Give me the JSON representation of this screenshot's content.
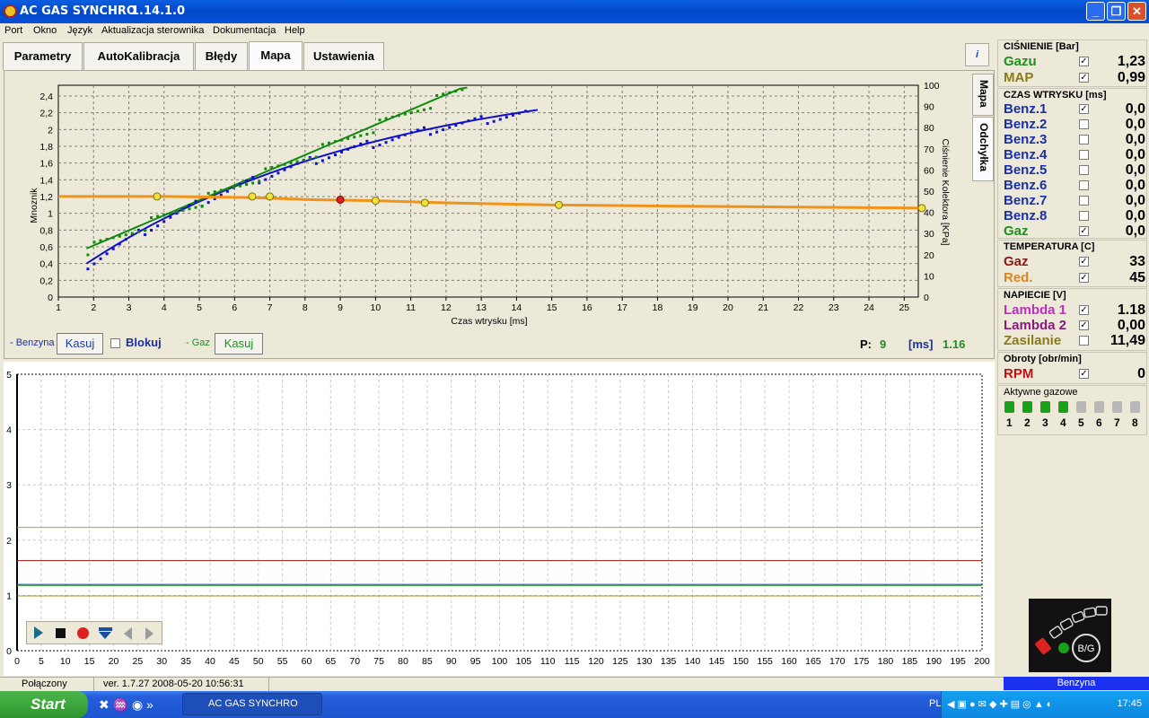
{
  "window": {
    "title": "AC GAS SYNCHRO",
    "version": "1.14.1.0"
  },
  "menu": [
    "Port",
    "Okno",
    "Język",
    "Aktualizacja sterownika",
    "Dokumentacja",
    "Help"
  ],
  "tabs": [
    "Parametry",
    "AutoKalibracja",
    "Błędy",
    "Mapa",
    "Ustawienia"
  ],
  "active_tab": "Mapa",
  "side_tabs": [
    "Mapa",
    "Odchyłka"
  ],
  "map": {
    "ylabel_left": "Mnoznik",
    "ylabel_right": "Ciśnienie Kolektora [KPa]",
    "xlabel": "Czas wtrysku [ms]",
    "left_ticks": [
      "2,4",
      "2,2",
      "2",
      "1,8",
      "1,6",
      "1,4",
      "1,2",
      "1",
      "0,8",
      "0,6",
      "0,4",
      "0,2",
      "0"
    ],
    "right_ticks": [
      "100",
      "90",
      "80",
      "70",
      "60",
      "50",
      "40",
      "30",
      "20",
      "10",
      "0"
    ],
    "x_ticks": [
      "1",
      "2",
      "3",
      "4",
      "5",
      "6",
      "7",
      "8",
      "9",
      "10",
      "11",
      "12",
      "13",
      "14",
      "15",
      "16",
      "17",
      "18",
      "19",
      "20",
      "21",
      "22",
      "23",
      "24",
      "25"
    ]
  },
  "controls": {
    "benzyna_label": "- Benzyna",
    "kasuj1": "Kasuj",
    "blokuj": "Blokuj",
    "gaz_label": "- Gaz",
    "kasuj2": "Kasuj",
    "p_label": "P:",
    "p_value": "9",
    "ms_label": "[ms]",
    "ms_value": "1.16"
  },
  "log": {
    "y_ticks": [
      "5",
      "4",
      "3",
      "2",
      "1",
      "0"
    ],
    "x_ticks": [
      "0",
      "5",
      "10",
      "15",
      "20",
      "25",
      "30",
      "35",
      "40",
      "45",
      "50",
      "55",
      "60",
      "65",
      "70",
      "75",
      "80",
      "85",
      "90",
      "95",
      "100",
      "105",
      "110",
      "115",
      "120",
      "125",
      "130",
      "135",
      "140",
      "145",
      "150",
      "155",
      "160",
      "165",
      "170",
      "175",
      "180",
      "185",
      "190",
      "195",
      "200"
    ]
  },
  "cisnienie": {
    "header": "CIŚNIENIE [Bar]",
    "rows": [
      {
        "name": "Gazu",
        "checked": true,
        "value": "1,23",
        "color": "#1f8f1f"
      },
      {
        "name": "MAP",
        "checked": true,
        "value": "0,99",
        "color": "#8a7a1a"
      }
    ]
  },
  "czas": {
    "header": "CZAS WTRYSKU  [ms]",
    "rows": [
      {
        "name": "Benz.1",
        "checked": true,
        "value": "0,0",
        "color": "#1a2fa8"
      },
      {
        "name": "Benz.2",
        "checked": false,
        "value": "0,0",
        "color": "#1a2fa8"
      },
      {
        "name": "Benz.3",
        "checked": false,
        "value": "0,0",
        "color": "#1a2fa8"
      },
      {
        "name": "Benz.4",
        "checked": false,
        "value": "0,0",
        "color": "#1a2fa8"
      },
      {
        "name": "Benz.5",
        "checked": false,
        "value": "0,0",
        "color": "#1a2fa8"
      },
      {
        "name": "Benz.6",
        "checked": false,
        "value": "0,0",
        "color": "#1a2fa8"
      },
      {
        "name": "Benz.7",
        "checked": false,
        "value": "0,0",
        "color": "#1a2fa8"
      },
      {
        "name": "Benz.8",
        "checked": false,
        "value": "0,0",
        "color": "#1a2fa8"
      },
      {
        "name": "Gaz",
        "checked": true,
        "value": "0,0",
        "color": "#1f8f1f"
      }
    ]
  },
  "temperatura": {
    "header": "TEMPERATURA  [C]",
    "rows": [
      {
        "name": "Gaz",
        "checked": true,
        "value": "33",
        "color": "#8a1a1a"
      },
      {
        "name": "Red.",
        "checked": true,
        "value": "45",
        "color": "#e0841a"
      }
    ]
  },
  "napiecie": {
    "header": "NAPIECIE [V]",
    "rows": [
      {
        "name": "Lambda 1",
        "checked": true,
        "value": "1.18",
        "color": "#c02cc0"
      },
      {
        "name": "Lambda 2",
        "checked": true,
        "value": "0,00",
        "color": "#8a1a7a"
      },
      {
        "name": "Zasilanie",
        "checked": false,
        "value": "11,49",
        "color": "#8a7a1a"
      }
    ]
  },
  "obroty": {
    "header": "Obroty [obr/min]",
    "rows": [
      {
        "name": "RPM",
        "checked": true,
        "value": "0",
        "color": "#c01010"
      }
    ]
  },
  "aktywne": {
    "header": "Aktywne gazowe",
    "numbers": [
      "1",
      "2",
      "3",
      "4",
      "5",
      "6",
      "7",
      "8"
    ],
    "active": [
      true,
      true,
      true,
      true,
      false,
      false,
      false,
      false
    ]
  },
  "indicator": {
    "label": "B/G"
  },
  "fuel_mode": "Benzyna",
  "status": {
    "connection": "Połączony",
    "version": "ver. 1.7.27   2008-05-20  10:56:31"
  },
  "taskbar": {
    "start": "Start",
    "app": "AC GAS SYNCHRO",
    "lang": "PL",
    "clock": "17:45"
  }
}
